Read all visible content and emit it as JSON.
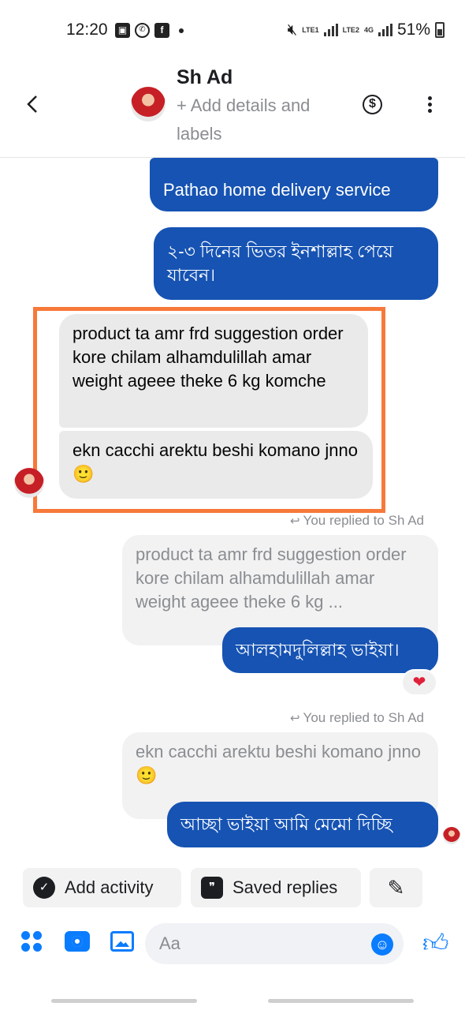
{
  "status_bar": {
    "time": "12:20",
    "battery": "51%",
    "sim1": "LTE1",
    "sim2": "LTE2",
    "network": "4G"
  },
  "header": {
    "contact_name": "Sh Ad",
    "subtitle": "+ Add details and labels",
    "dollar_glyph": "$"
  },
  "messages": {
    "out_delivery": "Pathao home delivery service",
    "out_days": "২-৩ দিনের ভিতর ইনশাল্লাহ পেয়ে যাবেন।",
    "in_product": "product ta amr frd suggestion order kore chilam alhamdulillah amar weight ageee theke 6 kg komche",
    "in_ekn": "ekn cacchi arektu beshi komano jnno🙂",
    "reply_label_1": "You replied to Sh Ad",
    "quote_1": "product ta amr frd suggestion order kore chilam alhamdulillah amar weight ageee theke 6 kg ...",
    "out_alhamdulillah": "আলহামদুলিল্লাহ ভাইয়া।",
    "reaction": "❤",
    "reply_label_2": "You replied to Sh Ad",
    "quote_2": "ekn cacchi arektu beshi komano jnno🙂",
    "out_memo": "আচ্ছা ভাইয়া আমি মেমো দিচ্ছি"
  },
  "quick_actions": {
    "add_activity": "Add activity",
    "saved_replies": "Saved replies"
  },
  "composer": {
    "placeholder": "Aa"
  },
  "colors": {
    "outgoing": "#1653b3",
    "incoming": "#eaeaea",
    "highlight": "#f7793a",
    "accent": "#0a7cff"
  },
  "icons": [
    "back-arrow-icon",
    "dollar-icon",
    "more-icon",
    "check-circle-icon",
    "chat-bubbles-icon",
    "pencil-icon",
    "apps-grid-icon",
    "camera-icon",
    "gallery-icon",
    "emoji-icon",
    "thumbs-up-icon",
    "reply-arrow-icon",
    "heart-icon"
  ]
}
